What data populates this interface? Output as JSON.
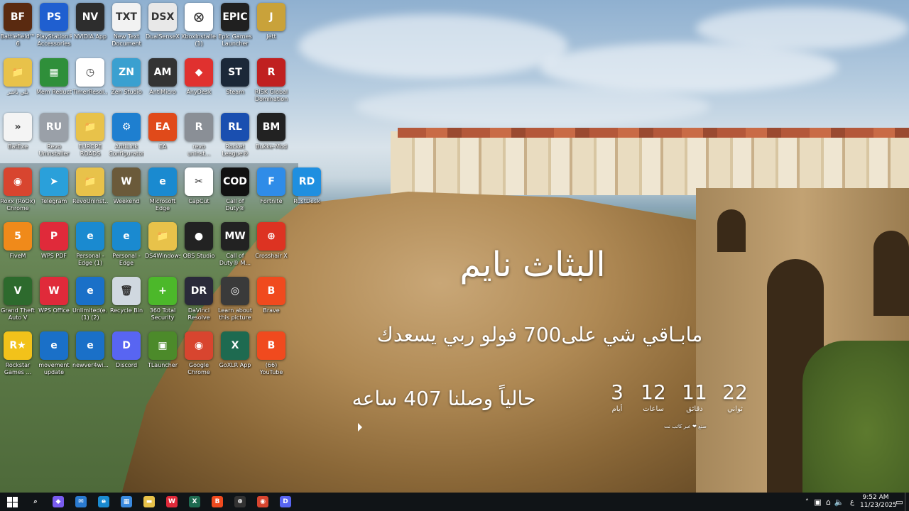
{
  "desktop": {
    "icons": [
      {
        "label": "Battlefield™ 6",
        "glyph": "BF",
        "color": "#5a2a10"
      },
      {
        "label": "PlayStation® Accessories",
        "glyph": "PS",
        "color": "#1f5fd0"
      },
      {
        "label": "NVIDIA App",
        "glyph": "NV",
        "color": "#2d2d2d"
      },
      {
        "label": "New Text Document",
        "glyph": "TXT",
        "color": "#f2f2f2"
      },
      {
        "label": "DualSenseX",
        "glyph": "DSX",
        "color": "#e8e8e8"
      },
      {
        "label": "XboxInstaller (1)",
        "glyph": "⨂",
        "color": "#ffffff"
      },
      {
        "label": "Epic Games Launcher",
        "glyph": "EPIC",
        "color": "#202020"
      },
      {
        "label": "Jett",
        "glyph": "J",
        "color": "#c9a23a"
      },
      {
        "label": "بلي باشر",
        "glyph": "📁",
        "color": "#e8c24a"
      },
      {
        "label": "Mem Reduct",
        "glyph": "▦",
        "color": "#2f8f3a"
      },
      {
        "label": "TimerResol...",
        "glyph": "◷",
        "color": "#ffffff"
      },
      {
        "label": "Zen Studio",
        "glyph": "ZN",
        "color": "#3aa0d0"
      },
      {
        "label": "AntiMicro",
        "glyph": "AM",
        "color": "#333333"
      },
      {
        "label": "AnyDesk",
        "glyph": "◆",
        "color": "#e0312f"
      },
      {
        "label": "Steam",
        "glyph": "ST",
        "color": "#1b2838"
      },
      {
        "label": "RISK Global Domination",
        "glyph": "R",
        "color": "#c02020"
      },
      {
        "label": "BatExe",
        "glyph": "»",
        "color": "#f4f4f4"
      },
      {
        "label": "Revo Uninstaller",
        "glyph": "RU",
        "color": "#9aa0a8"
      },
      {
        "label": "EUROPE ROADS",
        "glyph": "📁",
        "color": "#e8c24a"
      },
      {
        "label": "AntiLink Configurator",
        "glyph": "⚙",
        "color": "#1e7fd0"
      },
      {
        "label": "EA",
        "glyph": "EA",
        "color": "#e04a1a"
      },
      {
        "label": "revo uninst...",
        "glyph": "R",
        "color": "#8a8f96"
      },
      {
        "label": "Rocket League®",
        "glyph": "RL",
        "color": "#1a4fb0"
      },
      {
        "label": "Bukke-Mod",
        "glyph": "BM",
        "color": "#222222"
      },
      {
        "label": "Roxx (RoOx) Chrome",
        "glyph": "◉",
        "color": "#d8452f"
      },
      {
        "label": "Telegram",
        "glyph": "➤",
        "color": "#2aa0da"
      },
      {
        "label": "RevoUninst...",
        "glyph": "📁",
        "color": "#e8c24a"
      },
      {
        "label": "Weekend",
        "glyph": "W",
        "color": "#6b5a3a"
      },
      {
        "label": "Microsoft Edge",
        "glyph": "e",
        "color": "#1a8ad0"
      },
      {
        "label": "CapCut",
        "glyph": "✂",
        "color": "#ffffff"
      },
      {
        "label": "Call of Duty®",
        "glyph": "COD",
        "color": "#111111"
      },
      {
        "label": "Fortnite",
        "glyph": "F",
        "color": "#2f8ce8"
      },
      {
        "label": "RustDesk",
        "glyph": "RD",
        "color": "#1f8fe0"
      },
      {
        "label": "FiveM",
        "glyph": "5",
        "color": "#f08a1a"
      },
      {
        "label": "WPS PDF",
        "glyph": "P",
        "color": "#e02a3a"
      },
      {
        "label": "Personal - Edge (1)",
        "glyph": "e",
        "color": "#1a8ad0"
      },
      {
        "label": "Personal - Edge",
        "glyph": "e",
        "color": "#1a8ad0"
      },
      {
        "label": "DS4Windows",
        "glyph": "📁",
        "color": "#e8c24a"
      },
      {
        "label": "OBS Studio",
        "glyph": "●",
        "color": "#222222"
      },
      {
        "label": "Call of Duty® M...",
        "glyph": "MW",
        "color": "#222222"
      },
      {
        "label": "Crosshair X",
        "glyph": "⊕",
        "color": "#dd3322"
      },
      {
        "label": "Grand Theft Auto V",
        "glyph": "V",
        "color": "#2d6a2d"
      },
      {
        "label": "WPS Office",
        "glyph": "W",
        "color": "#e02a3a"
      },
      {
        "label": "Unlimited(e... (1) (2)",
        "glyph": "e",
        "color": "#1a70c8"
      },
      {
        "label": "Recycle Bin",
        "glyph": "🗑",
        "color": "#d0d8e0"
      },
      {
        "label": "360 Total Security",
        "glyph": "+",
        "color": "#4cb82a"
      },
      {
        "label": "DaVinci Resolve",
        "glyph": "DR",
        "color": "#2a2a3a"
      },
      {
        "label": "Learn about this picture",
        "glyph": "◎",
        "color": "#3a3a3a"
      },
      {
        "label": "Brave",
        "glyph": "B",
        "color": "#f04a1e"
      },
      {
        "label": "Rockstar Games ...",
        "glyph": "R★",
        "color": "#f2c21a"
      },
      {
        "label": "movement update",
        "glyph": "e",
        "color": "#1a70c8"
      },
      {
        "label": "newver4wi...",
        "glyph": "e",
        "color": "#1a70c8"
      },
      {
        "label": "Discord",
        "glyph": "D",
        "color": "#5865f2"
      },
      {
        "label": "TLauncher",
        "glyph": "▣",
        "color": "#4c8a2a"
      },
      {
        "label": "Google Chrome",
        "glyph": "◉",
        "color": "#d8452f"
      },
      {
        "label": "GoXLR App",
        "glyph": "X",
        "color": "#1e6a50"
      },
      {
        "label": "(66) YouTube",
        "glyph": "B",
        "color": "#f04a1e"
      }
    ]
  },
  "widget": {
    "title": "البثاث نايم",
    "subline": "مابـاقي  شي على700 فولو ربي يسعدك",
    "hours_line": "حالياً وصلنا 407 ساعه",
    "countdown": [
      {
        "value": "22",
        "unit": "ثواني"
      },
      {
        "value": "11",
        "unit": "دقائق"
      },
      {
        "value": "12",
        "unit": "ساعات"
      },
      {
        "value": "3",
        "unit": "أيام"
      }
    ],
    "note": "صنع ❤ عبر كاتب نت"
  },
  "taskbar": {
    "apps": [
      {
        "name": "search-icon",
        "glyph": "⌕",
        "color": "#101417"
      },
      {
        "name": "copilot-icon",
        "glyph": "◆",
        "color": "#7a5cf0"
      },
      {
        "name": "mail-icon",
        "glyph": "✉",
        "color": "#2a7ad0"
      },
      {
        "name": "edge-icon",
        "glyph": "e",
        "color": "#1a8ad0"
      },
      {
        "name": "store-icon",
        "glyph": "▦",
        "color": "#3a8ae0"
      },
      {
        "name": "file-explorer-icon",
        "glyph": "▬",
        "color": "#e8c24a"
      },
      {
        "name": "wps-icon",
        "glyph": "W",
        "color": "#e02a3a"
      },
      {
        "name": "goxlr-icon",
        "glyph": "X",
        "color": "#1e6a50"
      },
      {
        "name": "brave-icon",
        "glyph": "B",
        "color": "#f04a1e"
      },
      {
        "name": "crosshair-icon",
        "glyph": "⊕",
        "color": "#333333"
      },
      {
        "name": "chrome-icon",
        "glyph": "◉",
        "color": "#d8452f"
      },
      {
        "name": "discord-icon",
        "glyph": "D",
        "color": "#5865f2"
      }
    ],
    "tray": {
      "language": "ع",
      "time": "9:52 AM",
      "date": "11/23/2025"
    }
  }
}
